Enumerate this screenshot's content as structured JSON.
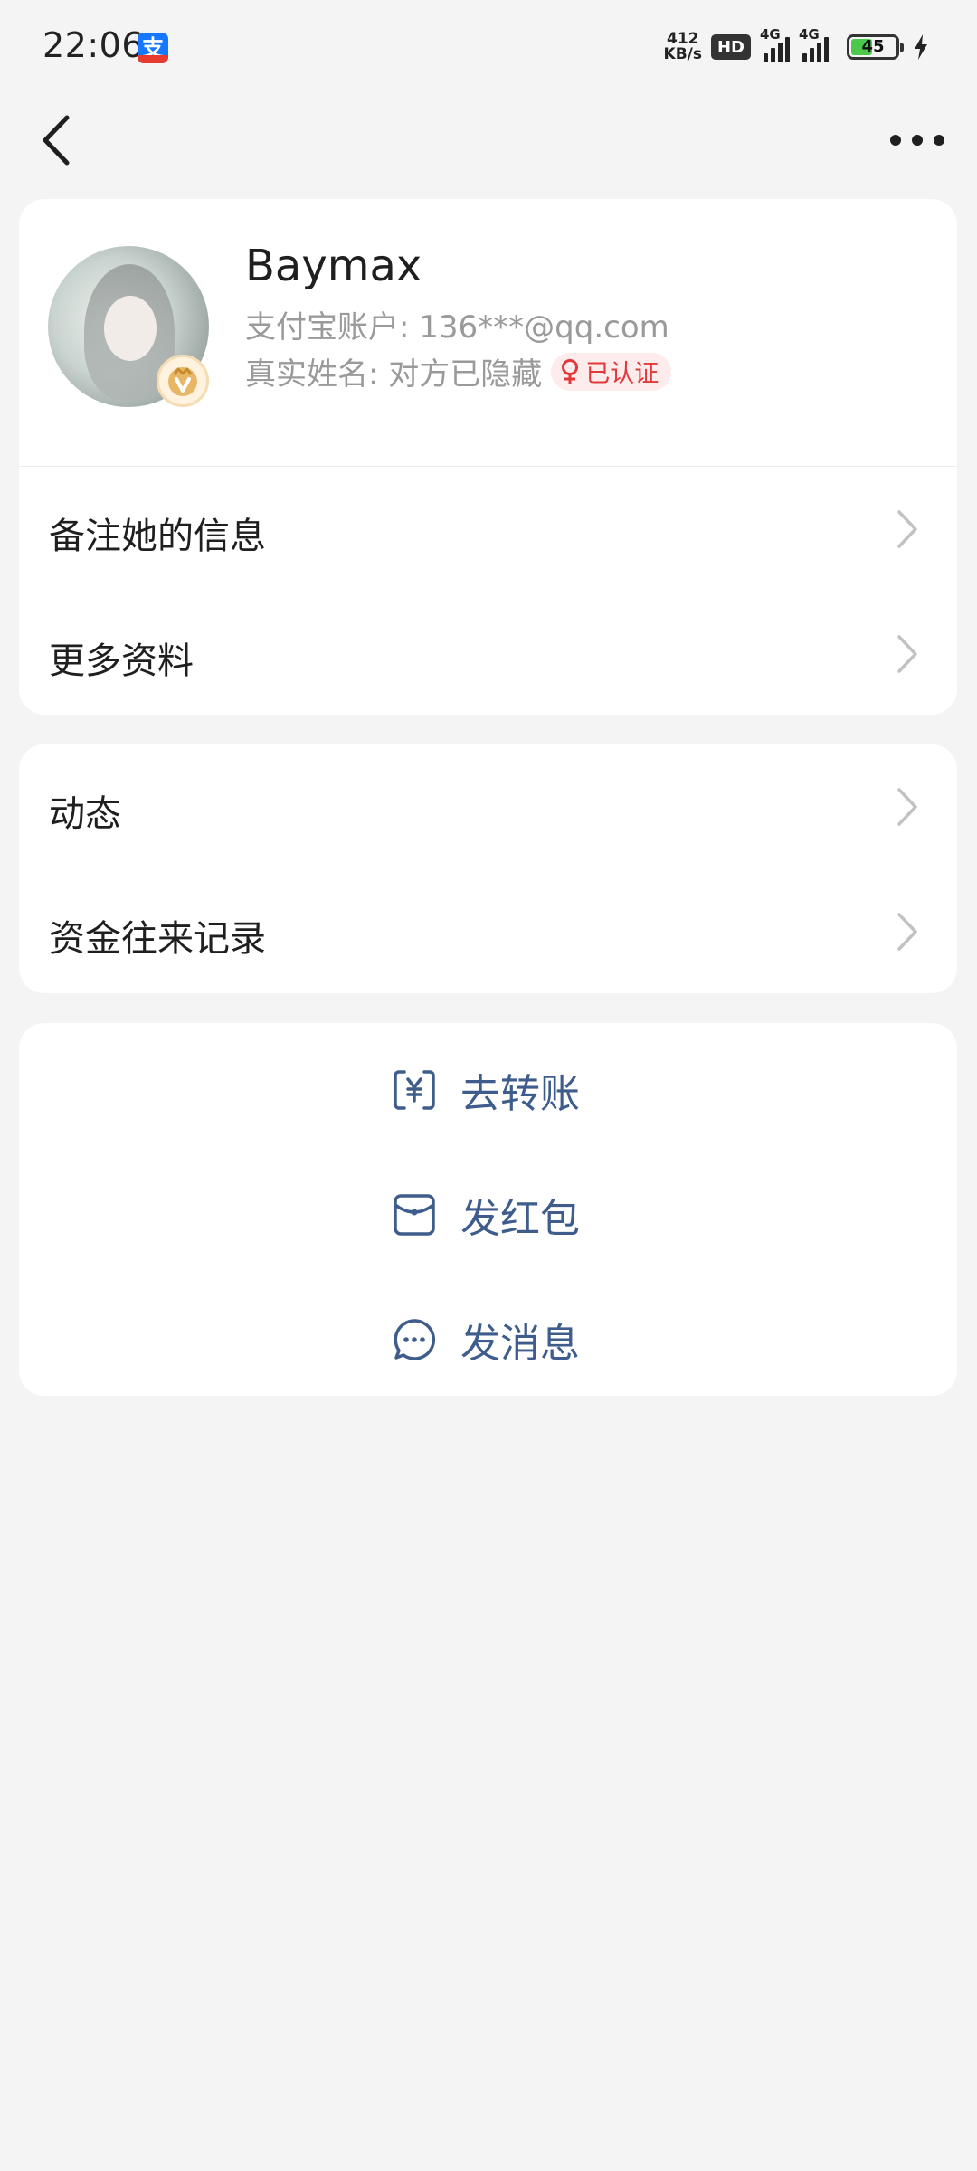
{
  "status_bar": {
    "time": "22:06",
    "app_badge_char": "支",
    "net_speed_value": "412",
    "net_speed_unit": "KB/s",
    "hd_label": "HD",
    "network1": "4G",
    "network2": "4G",
    "battery_percent": "45"
  },
  "profile": {
    "name": "Baymax",
    "account": "支付宝账户: 136***@qq.com",
    "real_name": "真实姓名: 对方已隐藏",
    "verified": "已认证"
  },
  "menu_group_1": {
    "items": [
      {
        "label": "备注她的信息"
      },
      {
        "label": "更多资料"
      }
    ]
  },
  "menu_group_2": {
    "items": [
      {
        "label": "动态"
      },
      {
        "label": "资金往来记录"
      }
    ]
  },
  "actions": {
    "items": [
      {
        "label": "去转账",
        "icon": "transfer-icon"
      },
      {
        "label": "发红包",
        "icon": "red-packet-icon"
      },
      {
        "label": "发消息",
        "icon": "message-icon"
      }
    ]
  },
  "colors": {
    "background": "#f4f4f4",
    "card": "#ffffff",
    "action_text": "#3f5d8c",
    "verified_text": "#e1383b",
    "secondary_text": "#9a9a9a"
  }
}
